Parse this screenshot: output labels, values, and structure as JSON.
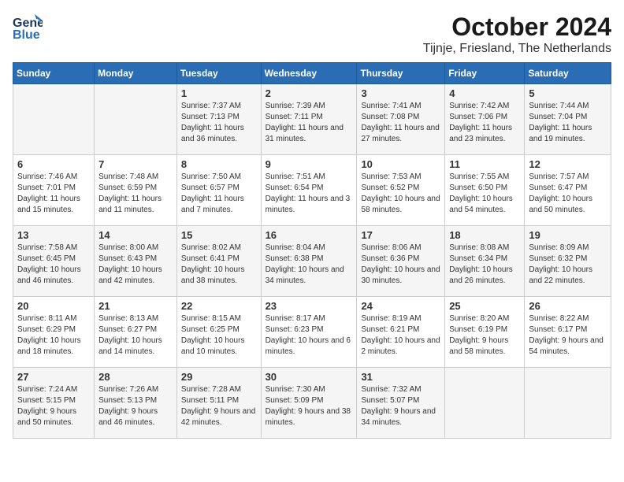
{
  "header": {
    "logo_general": "General",
    "logo_blue": "Blue",
    "title": "October 2024",
    "subtitle": "Tijnje, Friesland, The Netherlands"
  },
  "days_of_week": [
    "Sunday",
    "Monday",
    "Tuesday",
    "Wednesday",
    "Thursday",
    "Friday",
    "Saturday"
  ],
  "weeks": [
    [
      {
        "day": "",
        "content": ""
      },
      {
        "day": "",
        "content": ""
      },
      {
        "day": "1",
        "content": "Sunrise: 7:37 AM\nSunset: 7:13 PM\nDaylight: 11 hours and 36 minutes."
      },
      {
        "day": "2",
        "content": "Sunrise: 7:39 AM\nSunset: 7:11 PM\nDaylight: 11 hours and 31 minutes."
      },
      {
        "day": "3",
        "content": "Sunrise: 7:41 AM\nSunset: 7:08 PM\nDaylight: 11 hours and 27 minutes."
      },
      {
        "day": "4",
        "content": "Sunrise: 7:42 AM\nSunset: 7:06 PM\nDaylight: 11 hours and 23 minutes."
      },
      {
        "day": "5",
        "content": "Sunrise: 7:44 AM\nSunset: 7:04 PM\nDaylight: 11 hours and 19 minutes."
      }
    ],
    [
      {
        "day": "6",
        "content": "Sunrise: 7:46 AM\nSunset: 7:01 PM\nDaylight: 11 hours and 15 minutes."
      },
      {
        "day": "7",
        "content": "Sunrise: 7:48 AM\nSunset: 6:59 PM\nDaylight: 11 hours and 11 minutes."
      },
      {
        "day": "8",
        "content": "Sunrise: 7:50 AM\nSunset: 6:57 PM\nDaylight: 11 hours and 7 minutes."
      },
      {
        "day": "9",
        "content": "Sunrise: 7:51 AM\nSunset: 6:54 PM\nDaylight: 11 hours and 3 minutes."
      },
      {
        "day": "10",
        "content": "Sunrise: 7:53 AM\nSunset: 6:52 PM\nDaylight: 10 hours and 58 minutes."
      },
      {
        "day": "11",
        "content": "Sunrise: 7:55 AM\nSunset: 6:50 PM\nDaylight: 10 hours and 54 minutes."
      },
      {
        "day": "12",
        "content": "Sunrise: 7:57 AM\nSunset: 6:47 PM\nDaylight: 10 hours and 50 minutes."
      }
    ],
    [
      {
        "day": "13",
        "content": "Sunrise: 7:58 AM\nSunset: 6:45 PM\nDaylight: 10 hours and 46 minutes."
      },
      {
        "day": "14",
        "content": "Sunrise: 8:00 AM\nSunset: 6:43 PM\nDaylight: 10 hours and 42 minutes."
      },
      {
        "day": "15",
        "content": "Sunrise: 8:02 AM\nSunset: 6:41 PM\nDaylight: 10 hours and 38 minutes."
      },
      {
        "day": "16",
        "content": "Sunrise: 8:04 AM\nSunset: 6:38 PM\nDaylight: 10 hours and 34 minutes."
      },
      {
        "day": "17",
        "content": "Sunrise: 8:06 AM\nSunset: 6:36 PM\nDaylight: 10 hours and 30 minutes."
      },
      {
        "day": "18",
        "content": "Sunrise: 8:08 AM\nSunset: 6:34 PM\nDaylight: 10 hours and 26 minutes."
      },
      {
        "day": "19",
        "content": "Sunrise: 8:09 AM\nSunset: 6:32 PM\nDaylight: 10 hours and 22 minutes."
      }
    ],
    [
      {
        "day": "20",
        "content": "Sunrise: 8:11 AM\nSunset: 6:29 PM\nDaylight: 10 hours and 18 minutes."
      },
      {
        "day": "21",
        "content": "Sunrise: 8:13 AM\nSunset: 6:27 PM\nDaylight: 10 hours and 14 minutes."
      },
      {
        "day": "22",
        "content": "Sunrise: 8:15 AM\nSunset: 6:25 PM\nDaylight: 10 hours and 10 minutes."
      },
      {
        "day": "23",
        "content": "Sunrise: 8:17 AM\nSunset: 6:23 PM\nDaylight: 10 hours and 6 minutes."
      },
      {
        "day": "24",
        "content": "Sunrise: 8:19 AM\nSunset: 6:21 PM\nDaylight: 10 hours and 2 minutes."
      },
      {
        "day": "25",
        "content": "Sunrise: 8:20 AM\nSunset: 6:19 PM\nDaylight: 9 hours and 58 minutes."
      },
      {
        "day": "26",
        "content": "Sunrise: 8:22 AM\nSunset: 6:17 PM\nDaylight: 9 hours and 54 minutes."
      }
    ],
    [
      {
        "day": "27",
        "content": "Sunrise: 7:24 AM\nSunset: 5:15 PM\nDaylight: 9 hours and 50 minutes."
      },
      {
        "day": "28",
        "content": "Sunrise: 7:26 AM\nSunset: 5:13 PM\nDaylight: 9 hours and 46 minutes."
      },
      {
        "day": "29",
        "content": "Sunrise: 7:28 AM\nSunset: 5:11 PM\nDaylight: 9 hours and 42 minutes."
      },
      {
        "day": "30",
        "content": "Sunrise: 7:30 AM\nSunset: 5:09 PM\nDaylight: 9 hours and 38 minutes."
      },
      {
        "day": "31",
        "content": "Sunrise: 7:32 AM\nSunset: 5:07 PM\nDaylight: 9 hours and 34 minutes."
      },
      {
        "day": "",
        "content": ""
      },
      {
        "day": "",
        "content": ""
      }
    ]
  ]
}
